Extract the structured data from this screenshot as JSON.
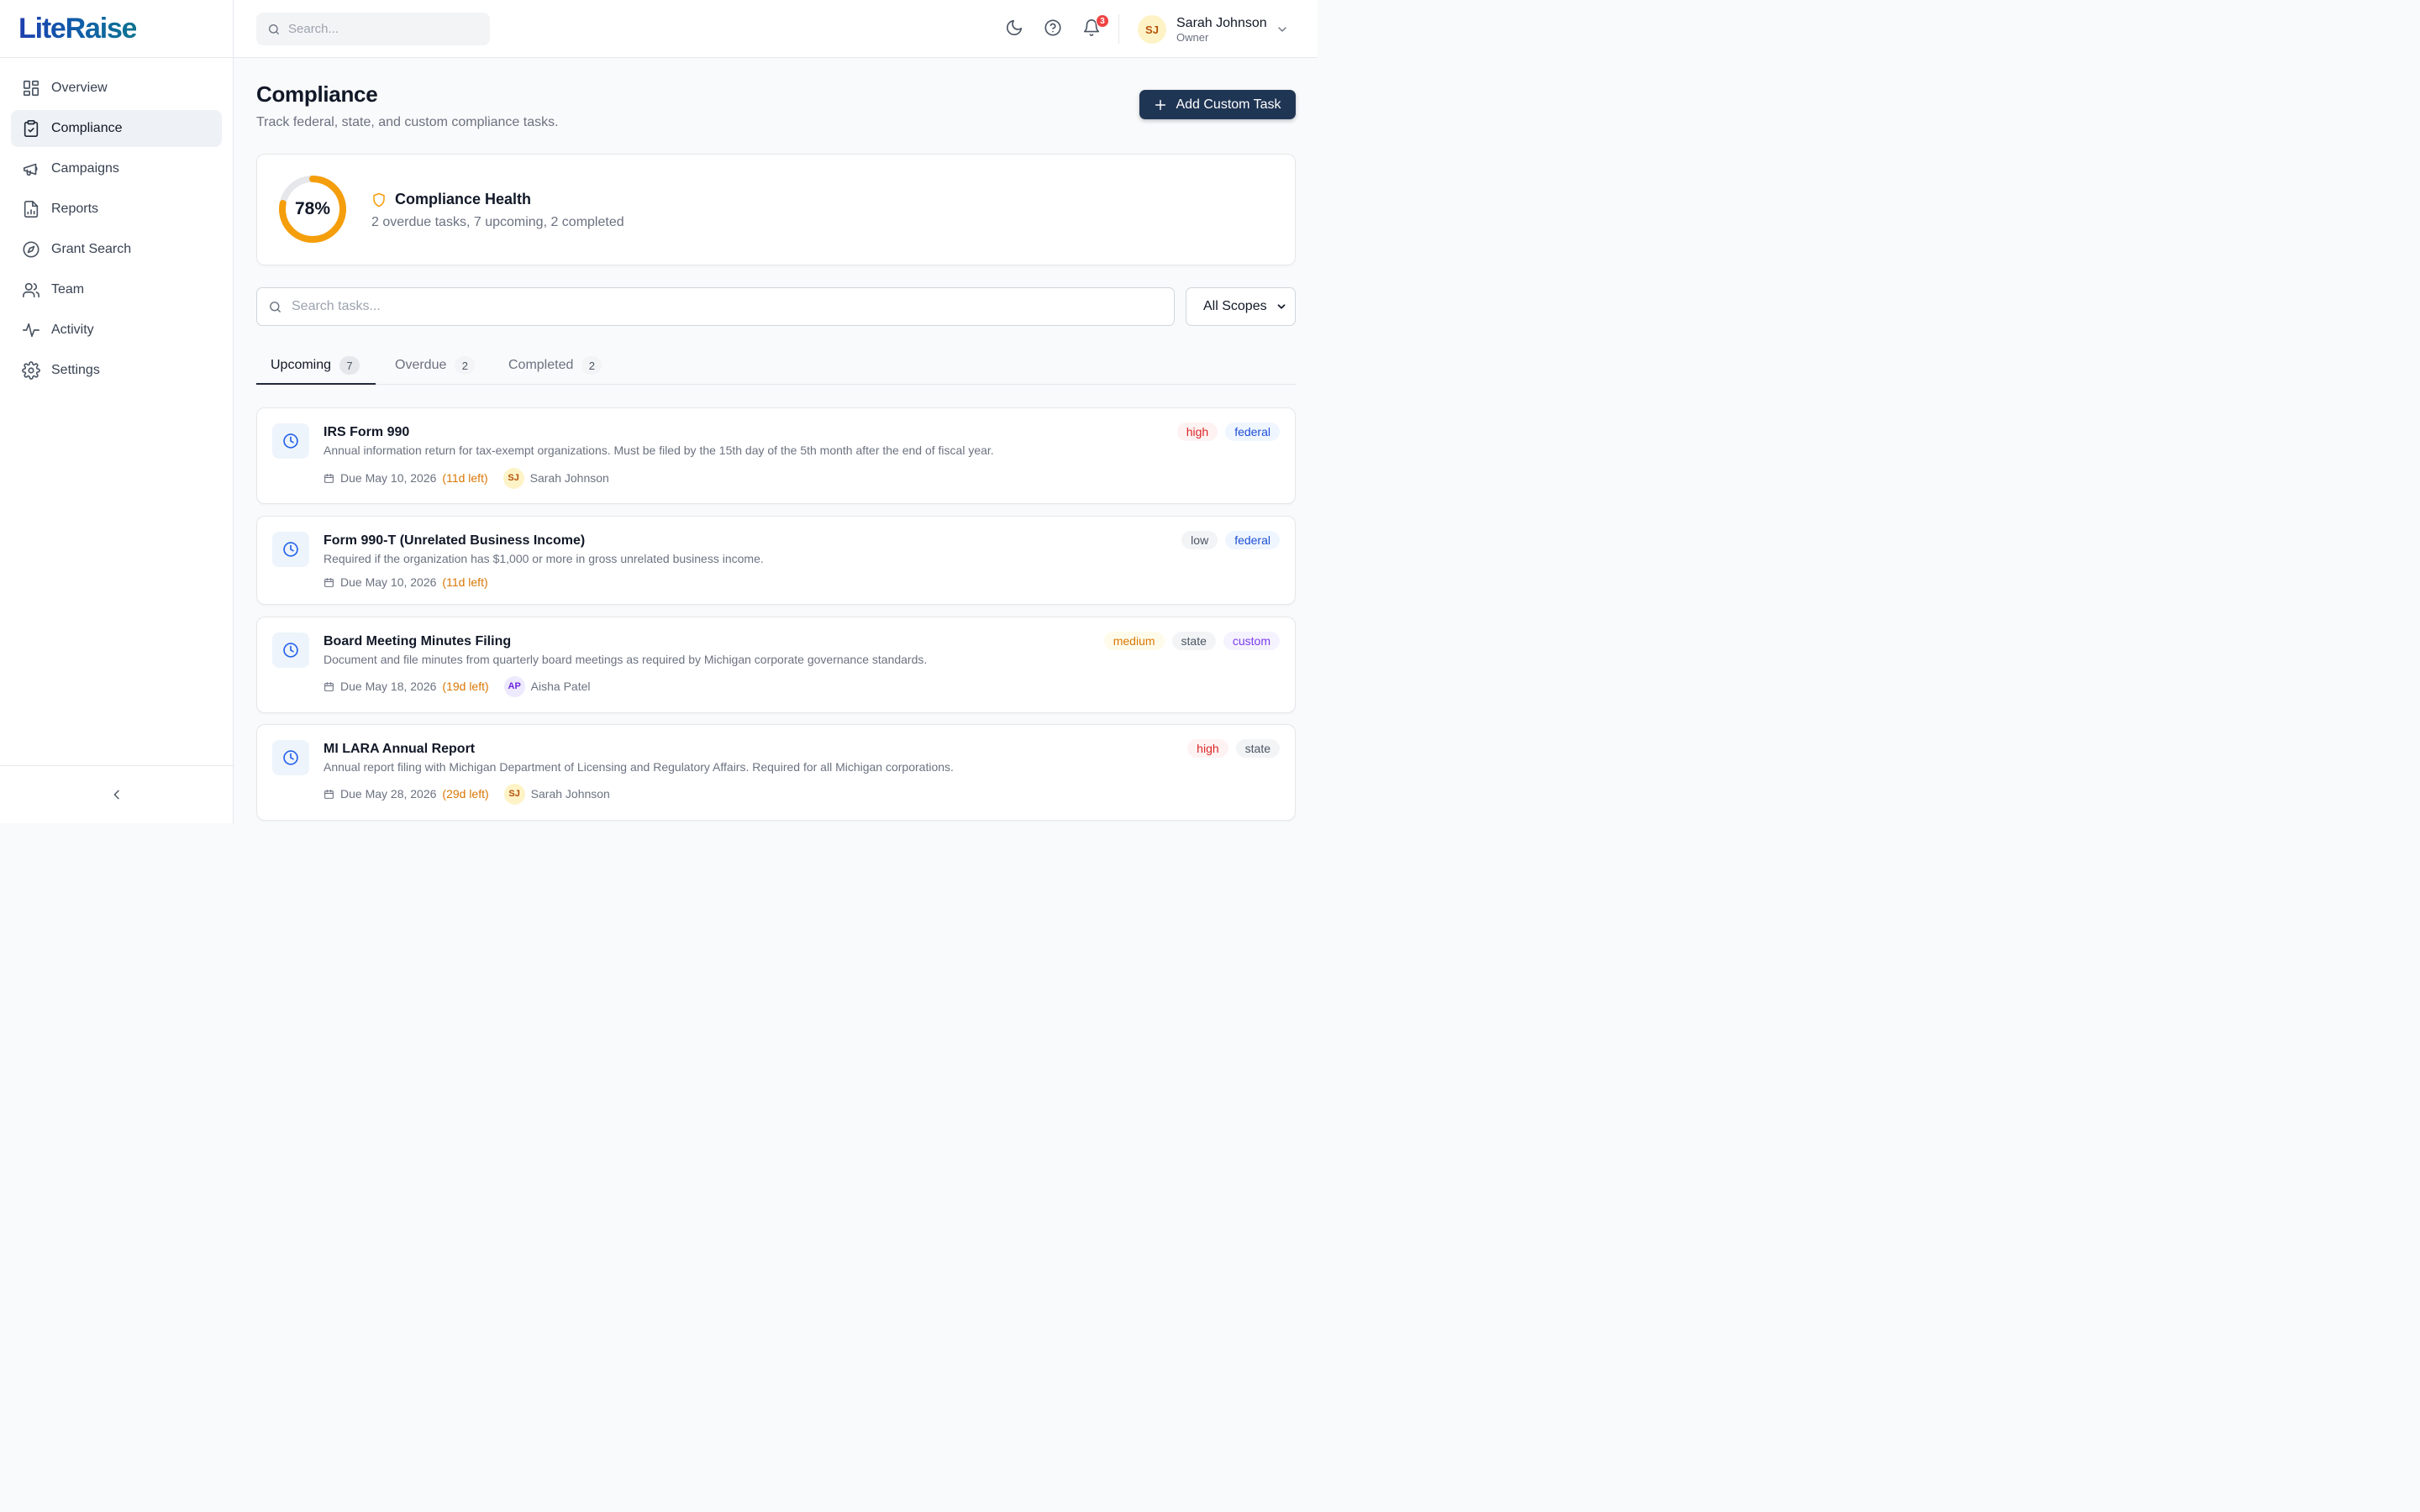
{
  "app": {
    "logo": "LiteRaise"
  },
  "sidebar": {
    "items": [
      {
        "label": "Overview",
        "icon": "grid-icon"
      },
      {
        "label": "Compliance",
        "icon": "clipboard-check-icon",
        "active": true
      },
      {
        "label": "Campaigns",
        "icon": "megaphone-icon"
      },
      {
        "label": "Reports",
        "icon": "file-chart-icon"
      },
      {
        "label": "Grant Search",
        "icon": "compass-icon"
      },
      {
        "label": "Team",
        "icon": "users-icon"
      },
      {
        "label": "Activity",
        "icon": "activity-icon"
      },
      {
        "label": "Settings",
        "icon": "gear-icon"
      }
    ]
  },
  "topbar": {
    "search_placeholder": "Search...",
    "notifications_count": "3",
    "user": {
      "initials": "SJ",
      "name": "Sarah Johnson",
      "role": "Owner"
    }
  },
  "page": {
    "title": "Compliance",
    "subtitle": "Track federal, state, and custom compliance tasks.",
    "add_button": "Add Custom Task"
  },
  "health": {
    "percent": 78,
    "percent_label": "78%",
    "title": "Compliance Health",
    "summary": "2 overdue tasks, 7 upcoming, 2 completed",
    "ring_color": "#f59e0b"
  },
  "filters": {
    "search_placeholder": "Search tasks...",
    "scope_selected": "All Scopes"
  },
  "tabs": [
    {
      "label": "Upcoming",
      "count": "7",
      "active": true
    },
    {
      "label": "Overdue",
      "count": "2"
    },
    {
      "label": "Completed",
      "count": "2"
    }
  ],
  "tasks": [
    {
      "title": "IRS Form 990",
      "description": "Annual information return for tax-exempt organizations. Must be filed by the 15th day of the 5th month after the end of fiscal year.",
      "due": "Due May 10, 2026",
      "left": "(11d left)",
      "assignee": {
        "initials": "SJ",
        "name": "Sarah Johnson"
      },
      "tags": [
        "high",
        "federal"
      ]
    },
    {
      "title": "Form 990-T (Unrelated Business Income)",
      "description": "Required if the organization has $1,000 or more in gross unrelated business income.",
      "due": "Due May 10, 2026",
      "left": "(11d left)",
      "tags": [
        "low",
        "federal"
      ]
    },
    {
      "title": "Board Meeting Minutes Filing",
      "description": "Document and file minutes from quarterly board meetings as required by Michigan corporate governance standards.",
      "due": "Due May 18, 2026",
      "left": "(19d left)",
      "assignee": {
        "initials": "AP",
        "name": "Aisha Patel"
      },
      "tags": [
        "medium",
        "state",
        "custom"
      ]
    },
    {
      "title": "MI LARA Annual Report",
      "description": "Annual report filing with Michigan Department of Licensing and Regulatory Affairs. Required for all Michigan corporations.",
      "due": "Due May 28, 2026",
      "left": "(29d left)",
      "assignee": {
        "initials": "SJ",
        "name": "Sarah Johnson"
      },
      "tags": [
        "high",
        "state"
      ]
    }
  ]
}
